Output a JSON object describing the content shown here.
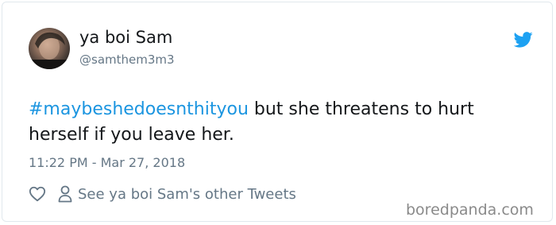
{
  "user": {
    "display_name": "ya boi Sam",
    "handle": "@samthem3m3"
  },
  "tweet": {
    "hashtag": "#maybeshedoesnthityou",
    "text": " but she threatens to hurt herself if you leave her.",
    "timestamp": "11:22 PM - Mar 27, 2018"
  },
  "actions": {
    "other_tweets_label": "See ya boi Sam's other Tweets"
  },
  "watermark": "boredpanda.com",
  "icons": {
    "brand": "twitter-bird-icon",
    "like": "heart-icon",
    "profile": "person-icon"
  },
  "colors": {
    "hashtag": "#1b95e0",
    "twitter_blue": "#1da1f2",
    "secondary_text": "#657786",
    "primary_text": "#14171a"
  }
}
